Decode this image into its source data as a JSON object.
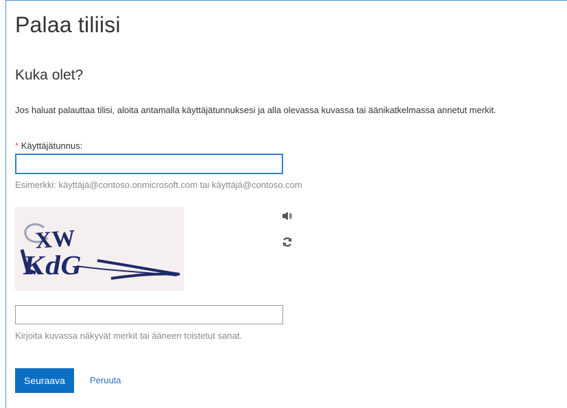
{
  "page": {
    "title": "Palaa tiliisi",
    "subtitle": "Kuka olet?",
    "intro": "Jos haluat palauttaa tilisi, aloita antamalla käyttäjätunnuksesi ja alla olevassa kuvassa tai äänikatkelmassa annetut merkit."
  },
  "username": {
    "required_mark": "*",
    "label": "Käyttäjätunnus:",
    "value": "",
    "hint": "Esimerkki: käyttäjä@contoso.onmicrosoft.com tai käyttäjä@contoso.com"
  },
  "captcha": {
    "image_text": "GXW KdG",
    "audio_icon": "speaker-icon",
    "refresh_icon": "refresh-icon",
    "answer_value": "",
    "hint": "Kirjoita kuvassa näkyvät merkit tai ääneen toistetut sanat."
  },
  "actions": {
    "next_label": "Seuraava",
    "cancel_label": "Peruuta"
  },
  "colors": {
    "accent": "#0a6fc2",
    "focus_border": "#2f7fd6",
    "link": "#2a6fc0",
    "required": "#d9534f",
    "captcha_ink": "#1f2a6a"
  }
}
